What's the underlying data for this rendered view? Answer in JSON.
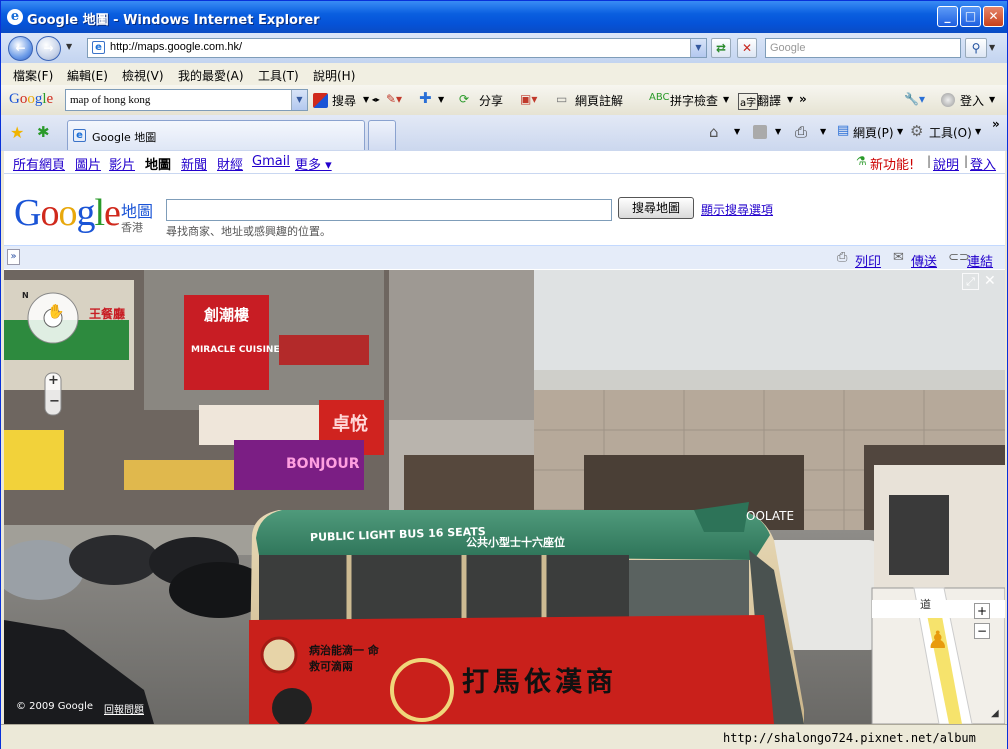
{
  "window": {
    "title": "Google 地圖 - Windows Internet Explorer"
  },
  "address": {
    "url": "http://maps.google.com.hk/"
  },
  "search": {
    "placeholder": "Google"
  },
  "menu": [
    "檔案(F)",
    "編輯(E)",
    "檢視(V)",
    "我的最愛(A)",
    "工具(T)",
    "說明(H)"
  ],
  "google_toolbar": {
    "query": "map of hong kong",
    "search_label": "搜尋",
    "share_label": "分享",
    "annotate_label": "網頁註解",
    "spell_label": "拼字檢查",
    "translate_label": "翻譯",
    "signin_label": "登入"
  },
  "tab": {
    "label": "Google 地圖"
  },
  "command_bar": {
    "page_label": "網頁(P)",
    "tools_label": "工具(O)"
  },
  "gbar": {
    "links": [
      "所有網頁",
      "圖片",
      "影片",
      "地圖",
      "新聞",
      "財經",
      "Gmail",
      "更多 ▾"
    ],
    "new_features": "新功能!",
    "help": "說明",
    "signin": "登入"
  },
  "maps": {
    "logo_suffix": "地圖",
    "logo_region": "香港",
    "search_button": "搜尋地圖",
    "hint": "尋找商家、地址或感興趣的位置。",
    "show_options": "顯示搜尋選項"
  },
  "actions": {
    "print": "列印",
    "send": "傳送",
    "link": "連結"
  },
  "streetview": {
    "copyright": "© 2009 Google",
    "report": "回報問題",
    "sign_restaurant": "創潮樓",
    "sign_restaurant_en": "MIRACLE CUISINE",
    "sign_bonjour": "BONJOUR",
    "sign_bonjour_cn": "卓悅",
    "bus_text": "PUBLIC LIGHT BUS 16 SEATS",
    "bus_text_cn": "公共小型士十六座位",
    "bus_ad": "打馬依漢商",
    "bus_ad2": "病治能滴一 命救可滴兩",
    "minimap_road": "道",
    "chocolate": "OOLATE",
    "sign_topleft": "王餐廳"
  },
  "statusbar": {
    "watermark": "http://shalongo724.pixnet.net/album"
  }
}
